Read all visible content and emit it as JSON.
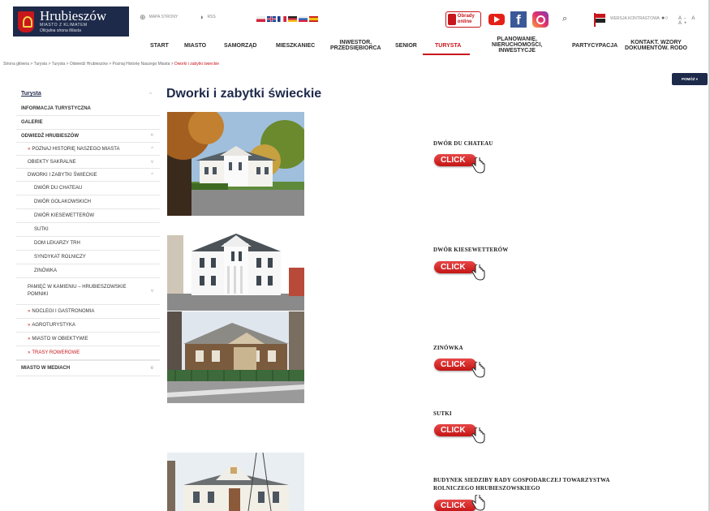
{
  "header": {
    "logo_title": "Hrubieszów",
    "logo_sub": "MIASTO Z KLIMATEM",
    "logo_sub2": "Oficjalna strona Miasta",
    "sitemap": "MAPA STRONY",
    "rss": "RSS",
    "obrady": "Obrady online",
    "kontrast": "WERSJA KONTRASTOWA",
    "font_sizes": "A- A A+"
  },
  "nav": [
    "START",
    "MIASTO",
    "SAMORZĄD",
    "MIESZKANIEC",
    "INWESTOR,\nPRZEDSIĘBIORCA",
    "SENIOR",
    "TURYSTA",
    "PLANOWANIE,\nNIERUCHOMOŚCI,\nINWESTYCJE",
    "PARTYCYPACJA",
    "KONTAKT. WZORY\nDOKUMENTÓW. RODO"
  ],
  "breadcrumb": {
    "path": "Strona główna  >  Turysta  >  Turysta  >  Odwiedź Hrubieszów  >  Poznaj Historię Naszego Miasta  > ",
    "current": "Dworki i zabytki świeckie"
  },
  "help_button": "POMÓŻ ▾",
  "sidebar": {
    "title": "Turysta",
    "items": [
      "INFORMACJA TURYSTYCZNA",
      "GALERIE",
      "ODWIEDŹ HRUBIESZÓW",
      "POZNAJ HISTORIĘ NASZEGO MIASTA",
      "OBIEKTY SAKRALNE",
      "DWORKI I ZABYTKI ŚWIECKIE",
      "DWÓR DU CHATEAU",
      "DWÓR GOLAKOWSKICH",
      "DWÓR KIESEWETTERÓW",
      "SUTKI",
      "DOM LEKARZY TRH",
      "SYNDYKAT ROLNICZY",
      "ZINÓWKA",
      "PAMIĘĆ W KAMIENIU – HRUBIESZOWSKIE POMNIKI",
      "NOCLEGI I GASTRONOMIA",
      "AGROTURYSTYKA",
      "MIASTO W OBIEKTYWIE",
      "TRASY ROWEROWE",
      "MIASTO W MEDIACH"
    ]
  },
  "main": {
    "title": "Dworki i zabytki świeckie",
    "click_label": "CLICK",
    "entries": [
      "DWÓR DU CHATEAU",
      "DWÓR KIESEWETTERÓW",
      "ZINÓWKA",
      "SUTKI",
      "BUDYNEK SIEDZIBY RADY GOSPODARCZEJ TOWARZYSTWA",
      "ROLNICZEGO HRUBIESZOWSKIEGO"
    ]
  },
  "colors": {
    "navy": "#1e2a4a",
    "accent_red": "#c8161d"
  }
}
